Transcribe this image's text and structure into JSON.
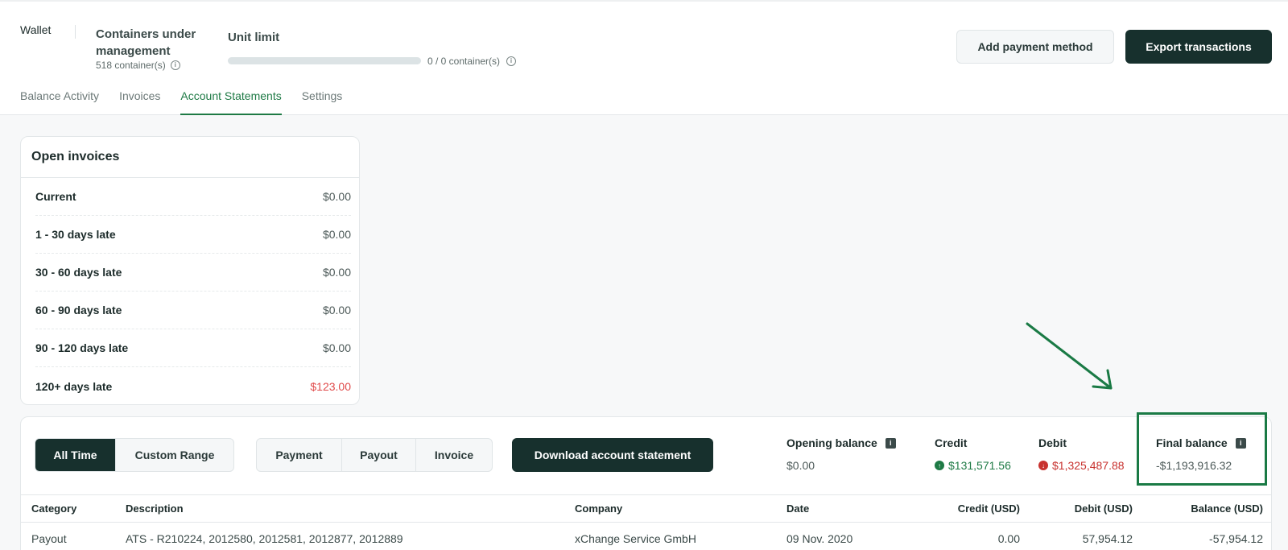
{
  "header": {
    "wallet_label": "Wallet",
    "containers": {
      "title": "Containers under management",
      "count": "518 container(s)"
    },
    "unit_limit": {
      "title": "Unit limit",
      "usage_text": "0 / 0 container(s)",
      "usage_fraction": 0
    },
    "buttons": {
      "add_payment": "Add payment method",
      "export": "Export transactions"
    }
  },
  "tabs": [
    {
      "label": "Balance Activity",
      "active": false
    },
    {
      "label": "Invoices",
      "active": false
    },
    {
      "label": "Account Statements",
      "active": true
    },
    {
      "label": "Settings",
      "active": false
    }
  ],
  "open_invoices": {
    "title": "Open invoices",
    "rows": [
      {
        "label": "Current",
        "value": "$0.00"
      },
      {
        "label": "1 - 30 days late",
        "value": "$0.00"
      },
      {
        "label": "30 - 60 days late",
        "value": "$0.00"
      },
      {
        "label": "60 - 90 days late",
        "value": "$0.00"
      },
      {
        "label": "90 - 120 days late",
        "value": "$0.00"
      },
      {
        "label": "120+ days late",
        "value": "$123.00"
      }
    ]
  },
  "statement": {
    "range_options": [
      "All Time",
      "Custom Range"
    ],
    "type_filters": [
      "Payment",
      "Payout",
      "Invoice"
    ],
    "download_label": "Download account statement",
    "stats": {
      "opening": {
        "label": "Opening balance",
        "value": "$0.00"
      },
      "credit": {
        "label": "Credit",
        "value": "$131,571.56"
      },
      "debit": {
        "label": "Debit",
        "value": "$1,325,487.88"
      },
      "final": {
        "label": "Final balance",
        "value": "-$1,193,916.32"
      }
    },
    "table": {
      "columns": [
        "Category",
        "Description",
        "Company",
        "Date",
        "Credit (USD)",
        "Debit (USD)",
        "Balance (USD)"
      ],
      "rows": [
        [
          "Payout",
          "ATS - R210224, 2012580, 2012581, 2012877, 2012889",
          "xChange Service GmbH",
          "09 Nov. 2020",
          "0.00",
          "57,954.12",
          "-57,954.12"
        ]
      ]
    }
  },
  "colors": {
    "accent": "#1e7a45",
    "dark": "#17302d",
    "danger": "#e04a4a"
  }
}
